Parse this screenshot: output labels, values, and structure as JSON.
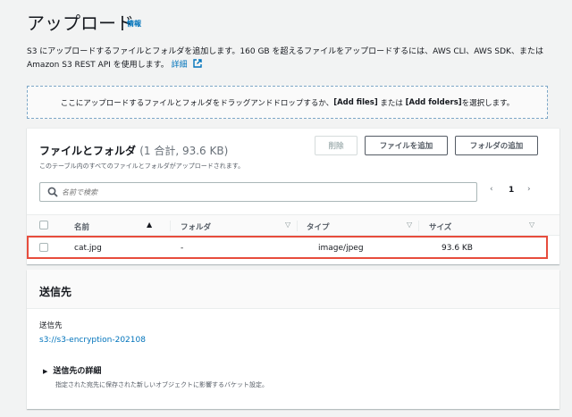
{
  "header": {
    "title": "アップロード",
    "info": "情報"
  },
  "description": {
    "text": "S3 にアップロードするファイルとフォルダを追加します。160 GB を超えるファイルをアップロードするには、AWS CLI、AWS SDK、または Amazon S3 REST API を使用します。",
    "link": "詳細"
  },
  "dropzone": {
    "before": "ここにアップロードするファイルとフォルダをドラッグアンドドロップするか、",
    "add_files": "[Add files]",
    "middle": " または ",
    "add_folders": "[Add folders]",
    "after": " を選択します。"
  },
  "files": {
    "title": "ファイルとフォルダ",
    "count": "(1 合計, 93.6 KB)",
    "subtitle": "このテーブル内のすべてのファイルとフォルダがアップロードされます。",
    "delete_button": "削除",
    "add_files_button": "ファイルを追加",
    "add_folder_button": "フォルダの追加",
    "search_placeholder": "名前で検索",
    "page": "1",
    "columns": [
      "名前",
      "フォルダ",
      "タイプ",
      "サイズ"
    ],
    "rows": [
      {
        "name": "cat.jpg",
        "folder": "-",
        "type": "image/jpeg",
        "size": "93.6 KB"
      }
    ]
  },
  "destination": {
    "title": "送信先",
    "label": "送信先",
    "uri": "s3://s3-encryption-202108",
    "details_label": "送信先の詳細",
    "details_note": "指定された宛先に保存された新しいオブジェクトに影響するバケット設定。"
  },
  "colors": {
    "link": "#0073bb",
    "highlight": "#e74c3c",
    "text": "#16191f"
  }
}
